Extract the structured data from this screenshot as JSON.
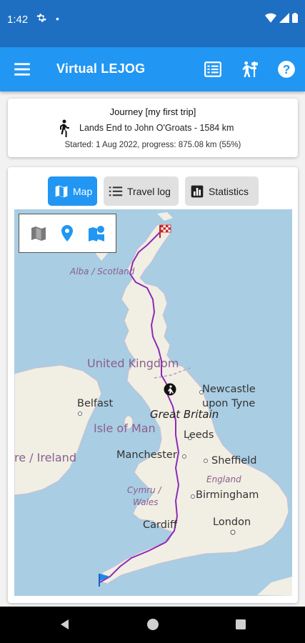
{
  "status_bar": {
    "time": "1:42",
    "dot": "•"
  },
  "app_bar": {
    "title": "Virtual LEJOG"
  },
  "journey": {
    "title": "Journey [my first trip]",
    "route": "Lands End to John O'Groats - 1584 km",
    "progress": "Started: 1 Aug 2022, progress: 875.08 km (55%)",
    "progress_fraction": 0.55
  },
  "tabs": {
    "map": "Map",
    "travel_log": "Travel log",
    "statistics": "Statistics"
  },
  "map": {
    "labels": {
      "alba": "Alba / Scotland",
      "uk": "United Kingdom",
      "newcastle_1": "Newcastle",
      "newcastle_2": "upon Tyne",
      "belfast": "Belfast",
      "great_britain": "Great Britain",
      "isle_of_man": "Isle of Man",
      "leeds": "Leeds",
      "ireland": "re / Ireland",
      "manchester": "Manchester",
      "sheffield": "Sheffield",
      "england": "England",
      "cymru": "Cymru /",
      "wales": "Wales",
      "birmingham": "Birmingham",
      "cardiff": "Cardiff",
      "london": "London"
    },
    "route_color": "#8e2ab5",
    "accent": "#2196f3"
  },
  "icons": {
    "menu": "menu-icon",
    "journal": "journal-icon",
    "hiker": "hiker-signpost-icon",
    "help": "help-icon"
  }
}
